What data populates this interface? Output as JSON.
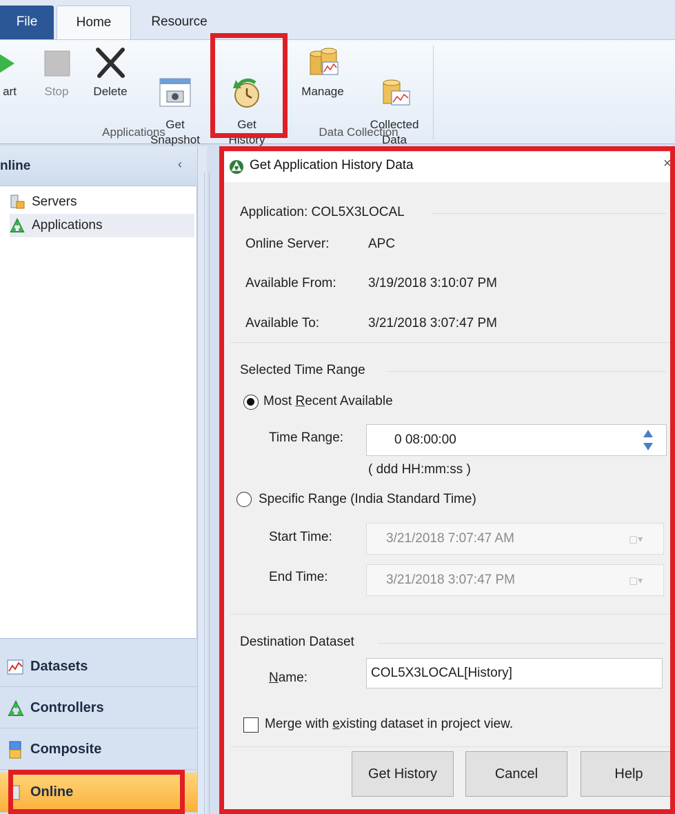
{
  "ribbon": {
    "tabs": {
      "file": "File",
      "home": "Home",
      "resource": "Resource"
    },
    "buttons": {
      "start": "art",
      "stop": "Stop",
      "delete": "Delete",
      "get_snapshot": "Get\nSnapshot",
      "get_history": "Get\nHistory",
      "manage": "Manage",
      "collected_data": "Collected\nData"
    },
    "groups": {
      "applications": "Applications",
      "data_collection": "Data Collection"
    }
  },
  "nav": {
    "title": "nline",
    "collapse_glyph": "‹",
    "tree": {
      "servers": "Servers",
      "applications": "Applications"
    },
    "buttons": {
      "datasets": "Datasets",
      "controllers": "Controllers",
      "composite": "Composite",
      "online": "Online"
    }
  },
  "dialog": {
    "title": "Get Application History Data",
    "close_glyph": "×",
    "application": "Application: COL5X3LOCAL",
    "online_server_label": "Online Server:",
    "online_server_value": "APC",
    "available_from_label": "Available From:",
    "available_from_value": "3/19/2018 3:10:07 PM",
    "available_to_label": "Available To:",
    "available_to_value": "3/21/2018 3:07:47 PM",
    "selected_time_range": "Selected Time Range",
    "most_recent_pre": "Most ",
    "most_recent_u": "R",
    "most_recent_post": "ecent Available",
    "time_range_label": "Time Range:",
    "time_range_value": "0  08:00:00",
    "time_range_hint": "( ddd HH:mm:ss )",
    "specific_range": "Specific Range (India Standard Time)",
    "start_time_label": "Start Time:",
    "start_time_value": "3/21/2018   7:07:47 AM",
    "end_time_label": "End Time:",
    "end_time_value": "3/21/2018   3:07:47 PM",
    "destination_dataset": "Destination Dataset",
    "name_label_u": "N",
    "name_label_rest": "ame:",
    "name_value": "COL5X3LOCAL[History]",
    "merge_pre": "Merge with ",
    "merge_u": "e",
    "merge_post": "xisting dataset in project view.",
    "buttons": {
      "get_history": "Get History",
      "cancel": "Cancel",
      "help": "Help"
    }
  },
  "colors": {
    "highlight": "#e01e25",
    "file_tab": "#2b5797",
    "online_nav": "#fbb03b"
  }
}
